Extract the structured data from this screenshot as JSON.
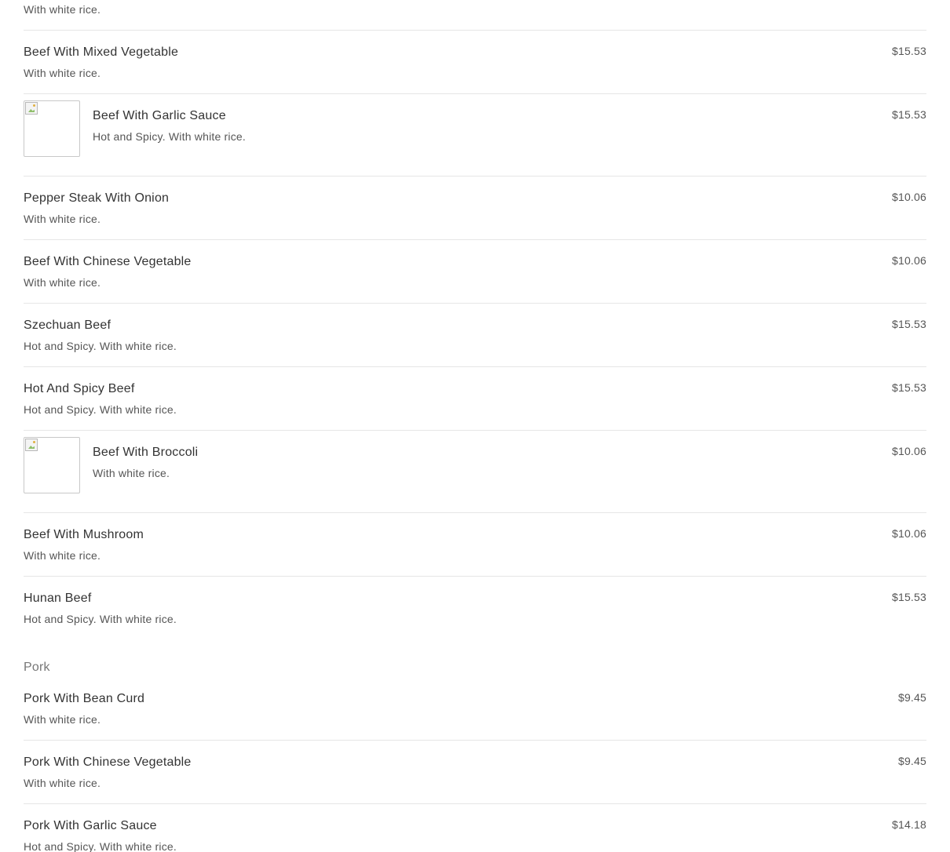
{
  "top_item_desc": "With white rice.",
  "beef_items": [
    {
      "name": "Beef With Mixed Vegetable",
      "desc": "With white rice.",
      "price": "$15.53"
    },
    {
      "name": "Beef With Garlic Sauce",
      "desc": "Hot and Spicy. With white rice.",
      "price": "$15.53"
    },
    {
      "name": "Pepper Steak With Onion",
      "desc": "With white rice.",
      "price": "$10.06"
    },
    {
      "name": "Beef With Chinese Vegetable",
      "desc": "With white rice.",
      "price": "$10.06"
    },
    {
      "name": "Szechuan Beef",
      "desc": "Hot and Spicy. With white rice.",
      "price": "$15.53"
    },
    {
      "name": "Hot And Spicy Beef",
      "desc": "Hot and Spicy. With white rice.",
      "price": "$15.53"
    },
    {
      "name": "Beef With Broccoli",
      "desc": "With white rice.",
      "price": "$10.06"
    },
    {
      "name": "Beef With Mushroom",
      "desc": "With white rice.",
      "price": "$10.06"
    },
    {
      "name": "Hunan Beef",
      "desc": "Hot and Spicy. With white rice.",
      "price": "$15.53"
    }
  ],
  "pork_category": "Pork",
  "pork_items": [
    {
      "name": "Pork With Bean Curd",
      "desc": "With white rice.",
      "price": "$9.45"
    },
    {
      "name": "Pork With Chinese Vegetable",
      "desc": "With white rice.",
      "price": "$9.45"
    },
    {
      "name": "Pork With Garlic Sauce",
      "desc": "Hot and Spicy. With white rice.",
      "price": "$14.18"
    }
  ]
}
